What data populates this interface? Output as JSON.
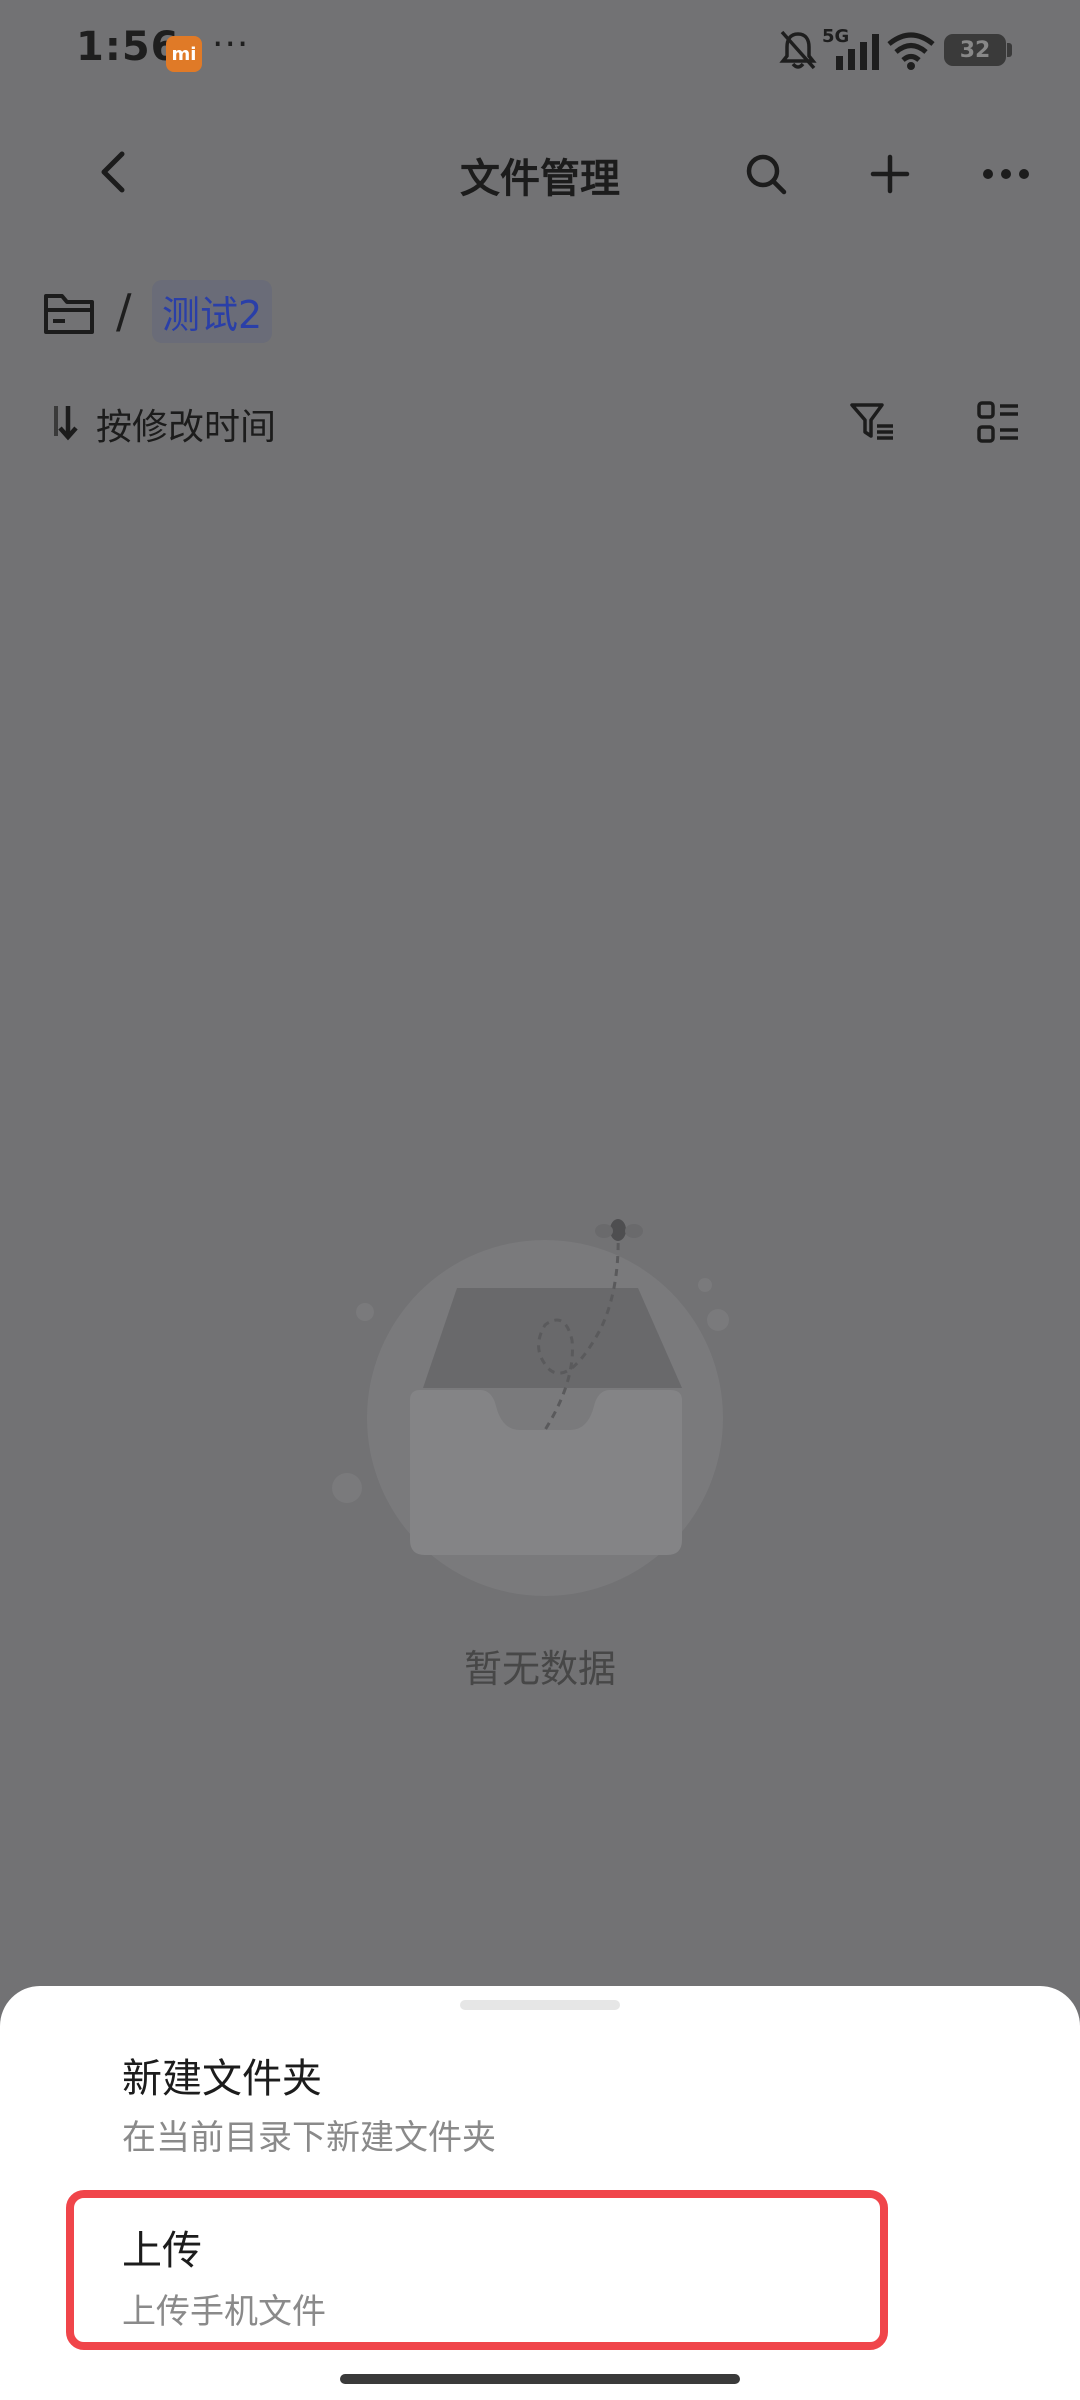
{
  "status_bar": {
    "time": "1:56",
    "badge": "mi",
    "more": "···",
    "network": "5G",
    "battery": "32"
  },
  "header": {
    "title": "文件管理"
  },
  "breadcrumb": {
    "separator": "/",
    "current": "测试2"
  },
  "toolbar": {
    "sort_label": "按修改时间"
  },
  "empty_state": {
    "text": "暂无数据"
  },
  "sheet": {
    "options": [
      {
        "title": "新建文件夹",
        "description": "在当前目录下新建文件夹"
      },
      {
        "title": "上传",
        "description": "上传手机文件"
      }
    ]
  },
  "colors": {
    "overlay": "#727274",
    "highlight": "#f0454a",
    "accent": "#2a3fa8"
  }
}
